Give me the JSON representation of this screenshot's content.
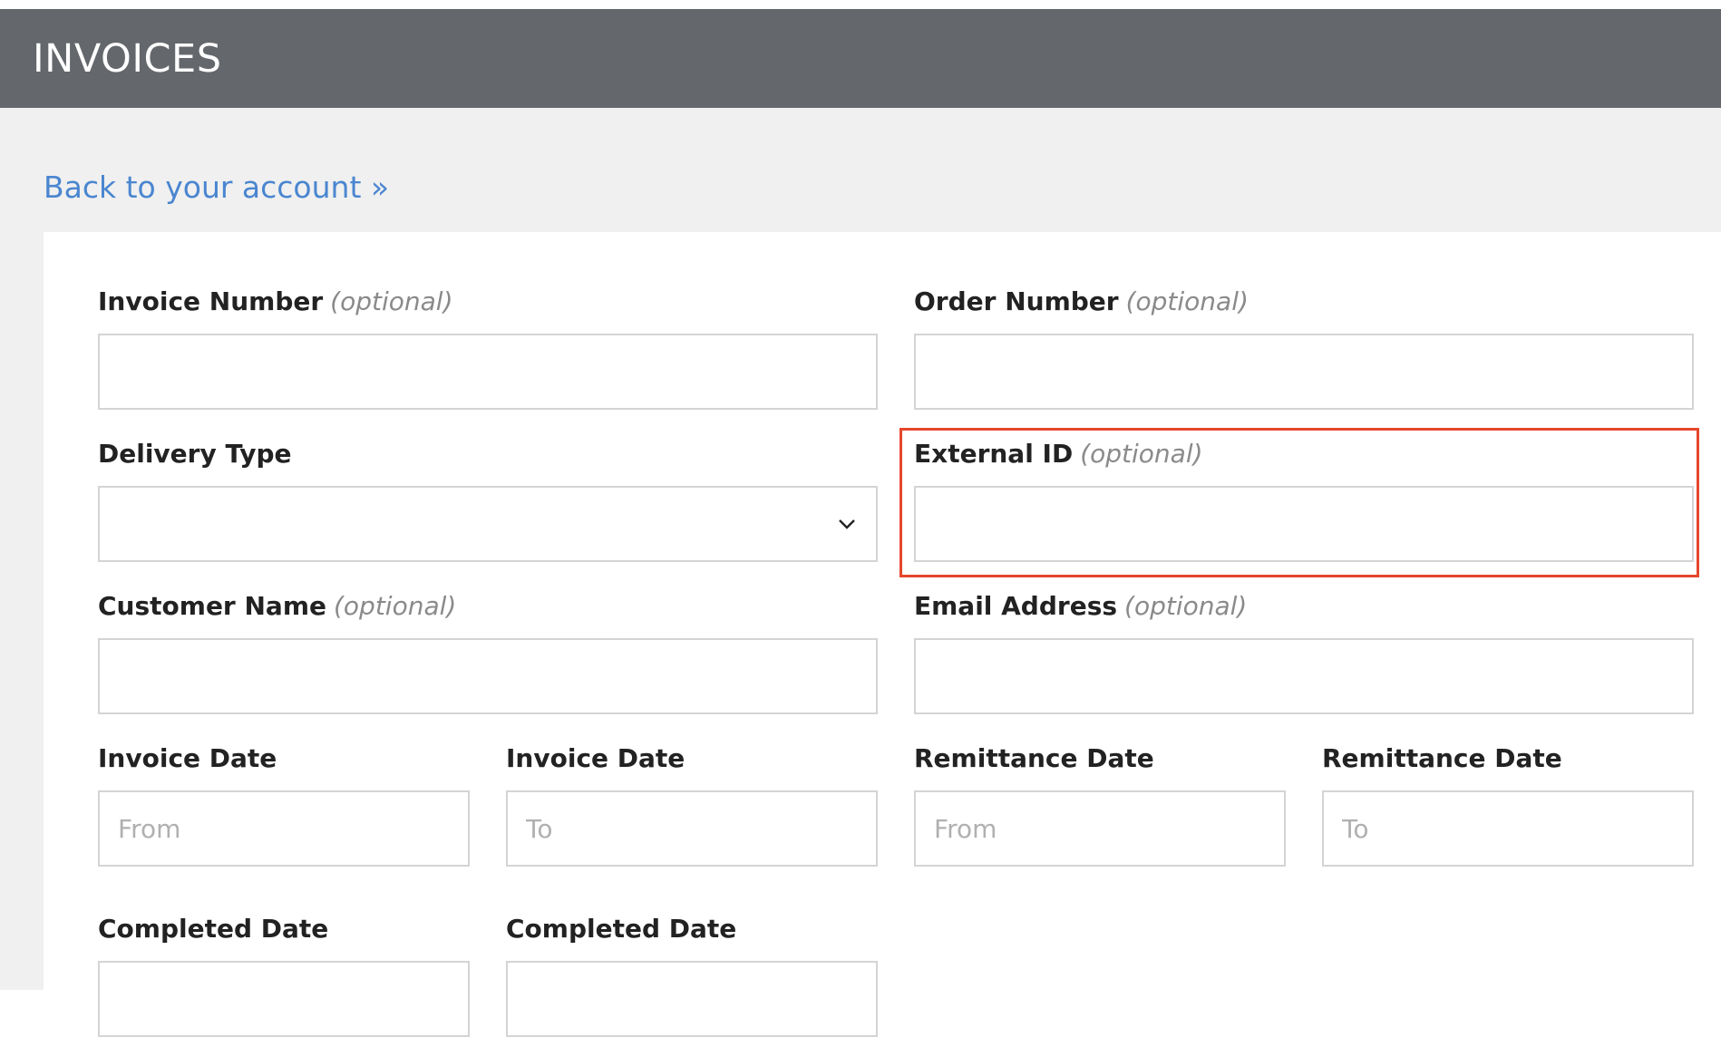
{
  "header": {
    "title": "INVOICES"
  },
  "nav": {
    "back_link": "Back to your account »"
  },
  "form": {
    "invoice_number": {
      "label": "Invoice Number",
      "optional": "(optional)",
      "value": ""
    },
    "order_number": {
      "label": "Order Number",
      "optional": "(optional)",
      "value": ""
    },
    "delivery_type": {
      "label": "Delivery Type",
      "selected": ""
    },
    "external_id": {
      "label": "External ID",
      "optional": "(optional)",
      "value": ""
    },
    "customer_name": {
      "label": "Customer Name",
      "optional": "(optional)",
      "value": ""
    },
    "email_address": {
      "label": "Email Address",
      "optional": "(optional)",
      "value": ""
    },
    "invoice_date_from": {
      "label": "Invoice Date",
      "placeholder": "From"
    },
    "invoice_date_to": {
      "label": "Invoice Date",
      "placeholder": "To"
    },
    "remittance_date_from": {
      "label": "Remittance Date",
      "placeholder": "From"
    },
    "remittance_date_to": {
      "label": "Remittance Date",
      "placeholder": "To"
    },
    "completed_date_from": {
      "label": "Completed Date"
    },
    "completed_date_to": {
      "label": "Completed Date"
    }
  },
  "colors": {
    "header_bg": "#64676b",
    "link": "#4a86d0",
    "highlight": "#e5472c"
  },
  "icons": {
    "dropdown": "chevron-down-icon"
  }
}
